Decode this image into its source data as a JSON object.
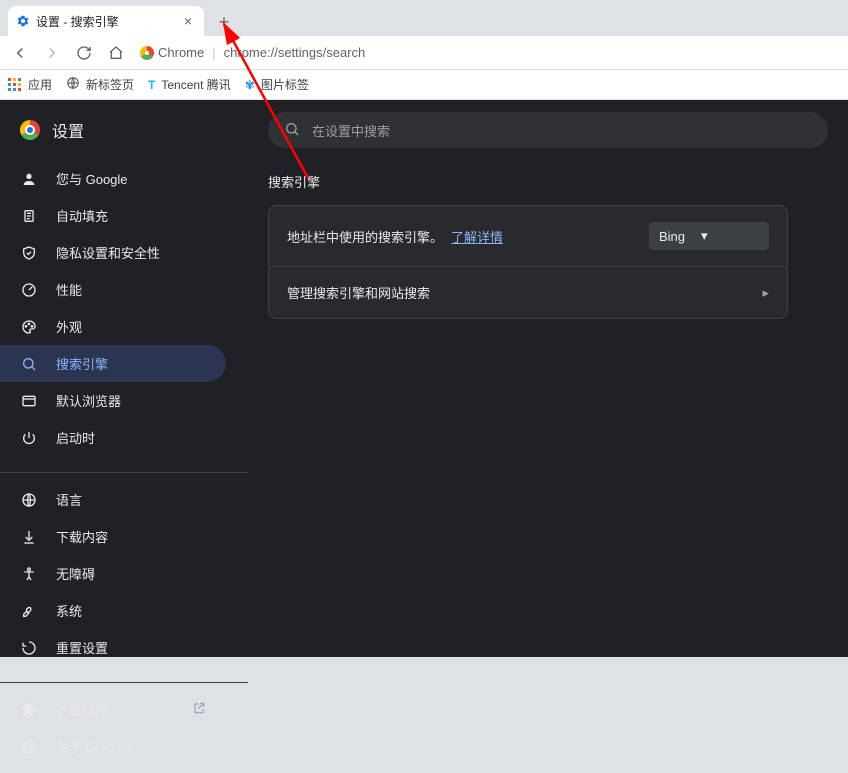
{
  "chrome": {
    "tab_title": "设置 - 搜索引擎",
    "omnibox_prefix": "Chrome",
    "url": "chrome://settings/search"
  },
  "bookmarks": {
    "apps": "应用",
    "items": [
      "新标签页",
      "Tencent 腾讯",
      "图片标签"
    ]
  },
  "sidebar": {
    "title": "设置",
    "group1": [
      {
        "label": "您与 Google"
      },
      {
        "label": "自动填充"
      },
      {
        "label": "隐私设置和安全性"
      },
      {
        "label": "性能"
      },
      {
        "label": "外观"
      },
      {
        "label": "搜索引擎"
      },
      {
        "label": "默认浏览器"
      },
      {
        "label": "启动时"
      }
    ],
    "group2": [
      {
        "label": "语言"
      },
      {
        "label": "下载内容"
      },
      {
        "label": "无障碍"
      },
      {
        "label": "系统"
      },
      {
        "label": "重置设置"
      }
    ],
    "group3": [
      {
        "label": "扩展程序"
      },
      {
        "label": "关于 Chrome"
      }
    ]
  },
  "main": {
    "search_placeholder": "在设置中搜索",
    "section_title": "搜索引擎",
    "row1_text": "地址栏中使用的搜索引擎。",
    "row1_link": "了解详情",
    "engine_selected": "Bing",
    "row2_text": "管理搜索引擎和网站搜索"
  }
}
